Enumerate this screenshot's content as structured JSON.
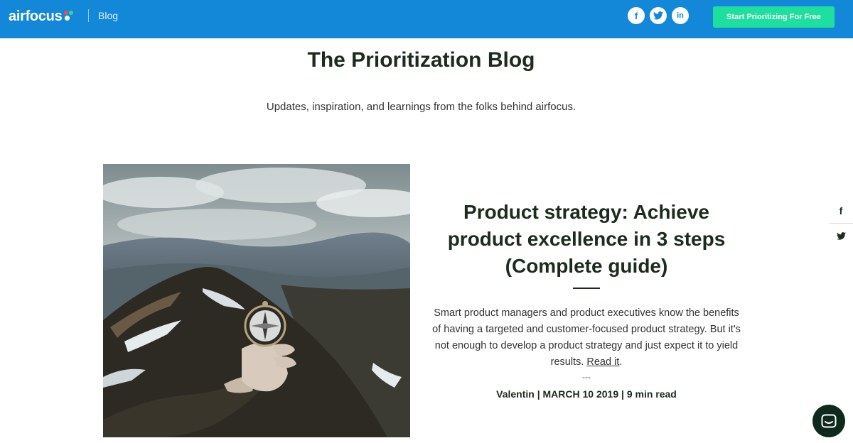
{
  "header": {
    "logo_text": "airfocus",
    "blog_label": "Blog",
    "social": [
      {
        "name": "facebook",
        "glyph": "f"
      },
      {
        "name": "twitter",
        "glyph": "t"
      },
      {
        "name": "linkedin",
        "glyph": "in"
      }
    ],
    "cta_label": "Start Prioritizing For Free",
    "colors": {
      "bar": "#1488d8",
      "cta": "#1fdf9f"
    }
  },
  "hero": {
    "title": "The Prioritization Blog",
    "subtitle": "Updates, inspiration, and learnings from the folks behind airfocus."
  },
  "featured_post": {
    "title": "Product strategy: Achieve product excellence in 3 steps (Complete guide)",
    "excerpt": "Smart product managers and product executives know the benefits of having a targeted and customer-focused product strategy. But it's not enough to develop a product strategy and just expect it to yield results.",
    "read_more": "Read it",
    "separator": "---",
    "meta": "Valentin | MARCH 10 2019 | 9 min read",
    "image_alt": "hand holding a compass on a mountain ridge"
  },
  "side_share": [
    {
      "name": "facebook",
      "glyph": "f"
    },
    {
      "name": "twitter",
      "glyph": "t"
    }
  ]
}
